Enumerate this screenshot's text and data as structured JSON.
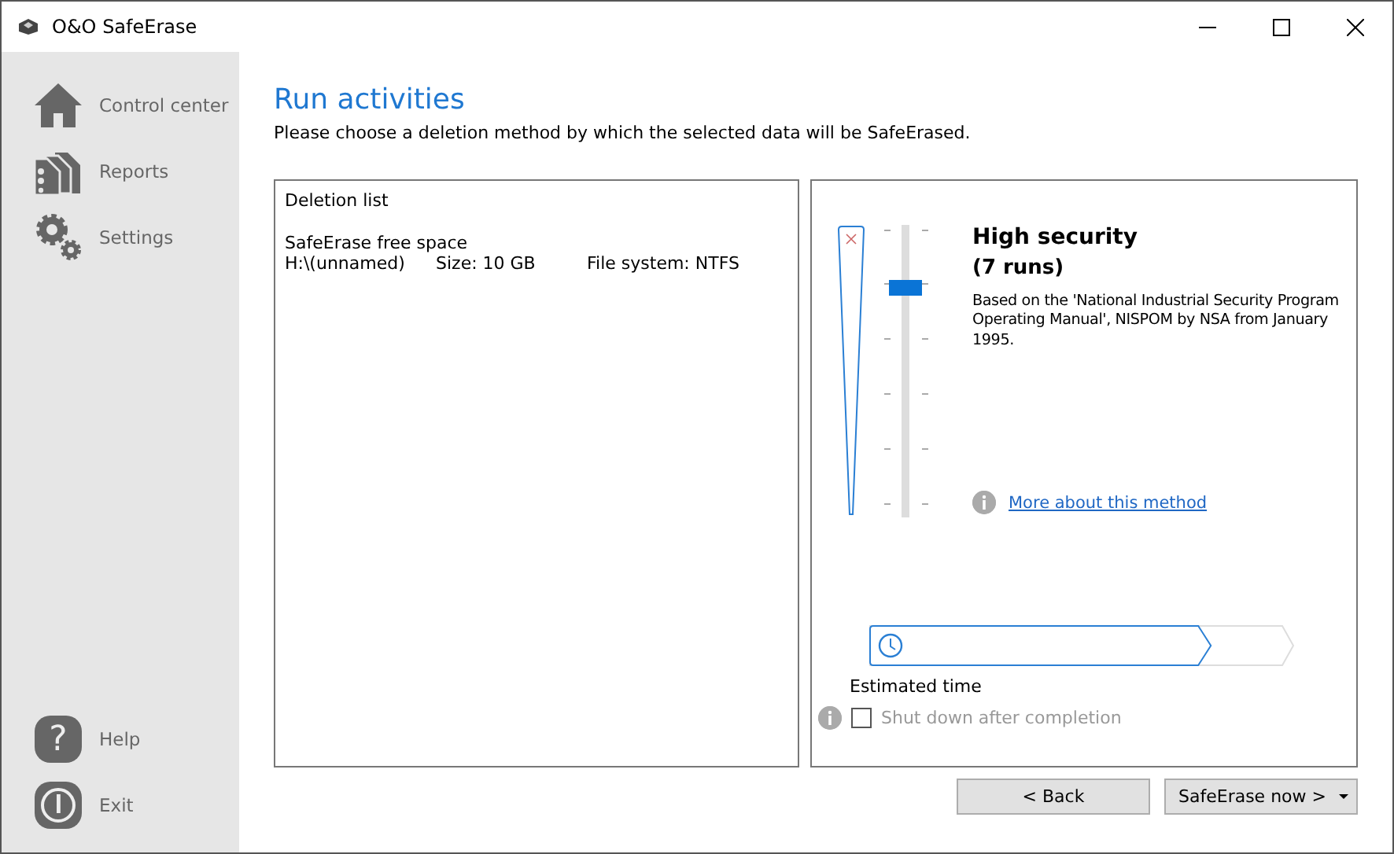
{
  "window": {
    "title": "O&O SafeErase"
  },
  "sidebar": {
    "items": [
      {
        "label": "Control center",
        "kind": "home"
      },
      {
        "label": "Reports",
        "kind": "reports"
      },
      {
        "label": "Settings",
        "kind": "settings"
      }
    ],
    "bottom_items": [
      {
        "label": "Help",
        "kind": "help",
        "glyph": "?"
      },
      {
        "label": "Exit",
        "kind": "exit"
      }
    ]
  },
  "header": {
    "title": "Run activities",
    "subtitle": "Please choose a deletion method by which the selected data will be SafeErased."
  },
  "deletion_list": {
    "title": "Deletion list",
    "items": [
      {
        "name": "SafeErase free space",
        "drive": "H:\\(unnamed)",
        "size": "Size: 10 GB",
        "file_system": "File system: NTFS"
      }
    ]
  },
  "method": {
    "level": 0.8,
    "title": "High security",
    "runs": "(7 runs)",
    "description": "Based on the 'National Industrial Security Program Operating Manual', NISPOM by NSA from January 1995.",
    "link": "More about this method"
  },
  "estimated_time": {
    "level": 0.8,
    "label": "Estimated time"
  },
  "shutdown": {
    "label": "Shut down after completion",
    "checked": false,
    "disabled": true
  },
  "buttons": {
    "back": "< Back",
    "primary": "SafeErase now >"
  }
}
